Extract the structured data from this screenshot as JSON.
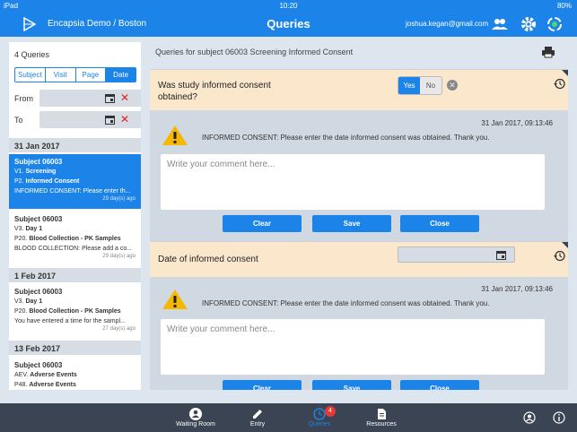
{
  "status_bar": {
    "carrier": "iPad",
    "time": "10:20",
    "battery": "80%"
  },
  "nav": {
    "app_title": "Encapsia Demo / Boston",
    "page_title": "Queries",
    "email": "joshua.kegan@gmail.com"
  },
  "sidebar": {
    "count_label": "4 Queries",
    "filter_tabs": [
      "Subject",
      "Visit",
      "Page",
      "Date"
    ],
    "selected_filter": "Date",
    "from_label": "From",
    "to_label": "To",
    "groups": [
      {
        "date": "31 Jan 2017",
        "items": [
          {
            "subject": "Subject 06003",
            "line1_code": "V1.",
            "line1_name": "Screening",
            "line2_code": "P2.",
            "line2_name": "Informed Consent",
            "text": "INFORMED CONSENT: Please enter th...",
            "age": "29 day(s) ago",
            "selected": true
          },
          {
            "subject": "Subject 06003",
            "line1_code": "V3.",
            "line1_name": "Day 1",
            "line2_code": "P20.",
            "line2_name": "Blood Collection - PK Samples",
            "text": "BLOOD COLLECTION: Please add a co...",
            "age": "29 day(s) ago",
            "selected": false
          }
        ]
      },
      {
        "date": "1 Feb 2017",
        "items": [
          {
            "subject": "Subject 06003",
            "line1_code": "V3.",
            "line1_name": "Day 1",
            "line2_code": "P20.",
            "line2_name": "Blood Collection - PK Samples",
            "text": "You have entered a time for the sampl...",
            "age": "27 day(s) ago",
            "selected": false
          }
        ]
      },
      {
        "date": "13 Feb 2017",
        "items": [
          {
            "subject": "Subject 06003",
            "line1_code": "AEV.",
            "line1_name": "Adverse Events",
            "line2_code": "P48.",
            "line2_name": "Adverse Events",
            "text": "",
            "age": "",
            "selected": false
          }
        ]
      }
    ]
  },
  "main": {
    "title": "Queries for subject 06003 Screening Informed Consent",
    "queries": [
      {
        "question": "Was study informed consent obtained?",
        "yes": "Yes",
        "no": "No",
        "selected": "Yes",
        "timestamp": "31 Jan 2017, 09:13:46",
        "message": "INFORMED CONSENT: Please enter the date informed consent was obtained. Thank you.",
        "comment_placeholder": "Write your comment here...",
        "clear": "Clear",
        "save": "Save",
        "close": "Close"
      },
      {
        "question": "Date of informed consent",
        "timestamp": "31 Jan 2017, 09:13:46",
        "message": "INFORMED CONSENT: Please enter the date informed consent was obtained. Thank you.",
        "comment_placeholder": "Write your comment here...",
        "clear": "Clear",
        "save": "Save",
        "close": "Close"
      }
    ]
  },
  "tabbar": {
    "items": [
      {
        "label": "Waiting Room",
        "icon": "person-icon"
      },
      {
        "label": "Entry",
        "icon": "pencil-icon"
      },
      {
        "label": "Queries",
        "icon": "clock-icon",
        "badge": "4",
        "active": true
      },
      {
        "label": "Resources",
        "icon": "document-icon"
      }
    ]
  },
  "colors": {
    "accent": "#1c84e8",
    "tabbar": "#3a4452",
    "query_header": "#fbe8cc",
    "warning": "#f5b800",
    "clear_x": "#e02020"
  }
}
